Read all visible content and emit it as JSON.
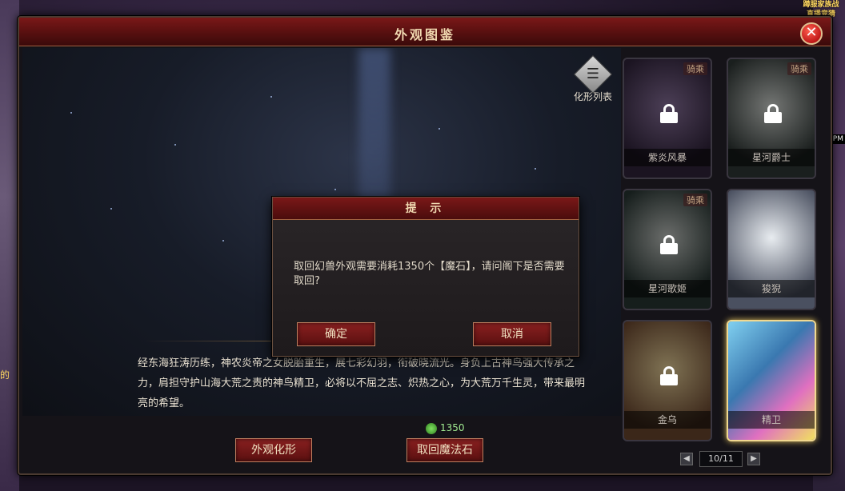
{
  "background": {
    "corner_text": "蹲服家族战 直播竞猜",
    "side_text": "的",
    "right_text": "PM"
  },
  "window": {
    "title": "外观图鉴",
    "close_icon": "close-icon"
  },
  "preview": {
    "list_button_label": "化形列表",
    "list_icon": "scroll-icon",
    "description": "经东海狂涛历练，神农炎帝之女脱胎重生，展七彩幻羽，衔破晓流光。身负上古神鸟强大传承之力，肩担守护山海大荒之责的神鸟精卫，必将以不屈之志、炽热之心，为大荒万千生灵，带来最明亮的希望。"
  },
  "price": {
    "icon": "magic-stone-icon",
    "value": "1350"
  },
  "buttons": {
    "transform": "外观化形",
    "reclaim": "取回魔法石"
  },
  "cards": [
    {
      "name": "紫炎风暴",
      "badge": "骑乘",
      "locked": true,
      "color": "#5a3a78"
    },
    {
      "name": "星河爵士",
      "badge": "骑乘",
      "locked": true,
      "color": "#3a5048"
    },
    {
      "name": "星河歌姬",
      "badge": "骑乘",
      "locked": true,
      "color": "#2a4840"
    },
    {
      "name": "狻猊",
      "badge": "",
      "locked": false,
      "color": "#8890a0"
    },
    {
      "name": "金乌",
      "badge": "",
      "locked": true,
      "color": "#c07020"
    },
    {
      "name": "精卫",
      "badge": "",
      "locked": false,
      "selected": true,
      "color": "#4aa0c0"
    }
  ],
  "pager": {
    "prev_icon": "chevron-left-icon",
    "next_icon": "chevron-right-icon",
    "text": "10/11"
  },
  "modal": {
    "title": "提  示",
    "message": "取回幻兽外观需要消耗1350个【魔石】，请问阁下是否需要取回?",
    "confirm": "确定",
    "cancel": "取消"
  }
}
